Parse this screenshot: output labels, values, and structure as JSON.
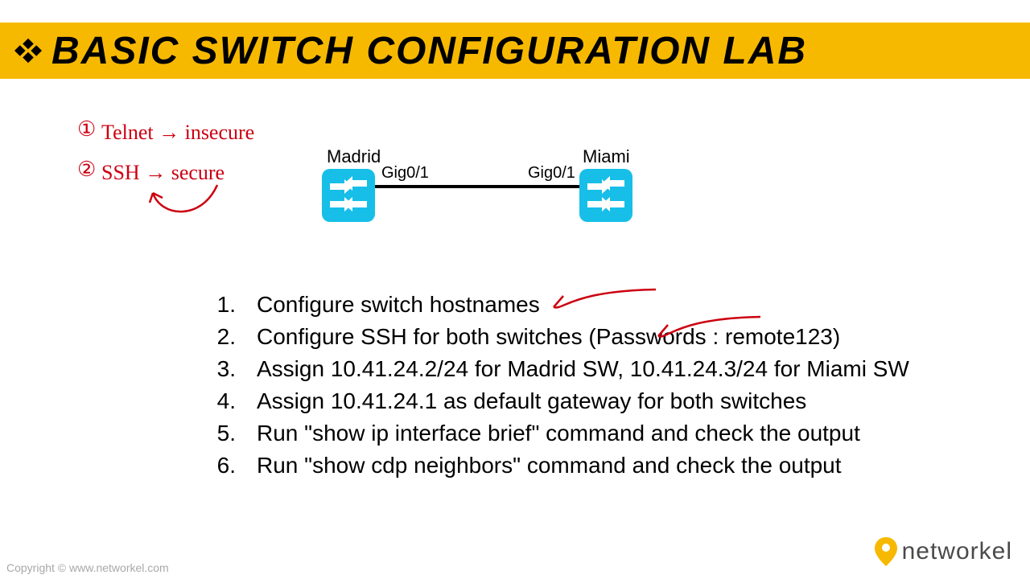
{
  "title": "BASIC SWITCH CONFIGURATION LAB",
  "handwriting": {
    "line1_num": "①",
    "line1_text": "Telnet → insecure",
    "line2_num": "②",
    "line2_text": "SSH → secure"
  },
  "topology": {
    "left_label": "Madrid",
    "right_label": "Miami",
    "left_port": "Gig0/1",
    "right_port": "Gig0/1"
  },
  "tasks": [
    {
      "num": "1.",
      "text": "Configure switch hostnames"
    },
    {
      "num": "2.",
      "text": "Configure SSH for both switches (Passwords : remote123)"
    },
    {
      "num": "3.",
      "text": "Assign 10.41.24.2/24 for Madrid SW, 10.41.24.3/24 for Miami SW"
    },
    {
      "num": "4.",
      "text": "Assign 10.41.24.1 as default gateway for both switches"
    },
    {
      "num": "5.",
      "text": "Run \"show ip interface brief\" command and check the output"
    },
    {
      "num": "6.",
      "text": "Run \"show cdp neighbors\" command and check the output"
    }
  ],
  "footer": {
    "copyright": "Copyright © www.networkel.com",
    "logo_text": "networkel"
  },
  "colors": {
    "banner": "#f7b900",
    "switch": "#17bfe8",
    "ink": "#cc0011",
    "pin": "#f7b900"
  }
}
